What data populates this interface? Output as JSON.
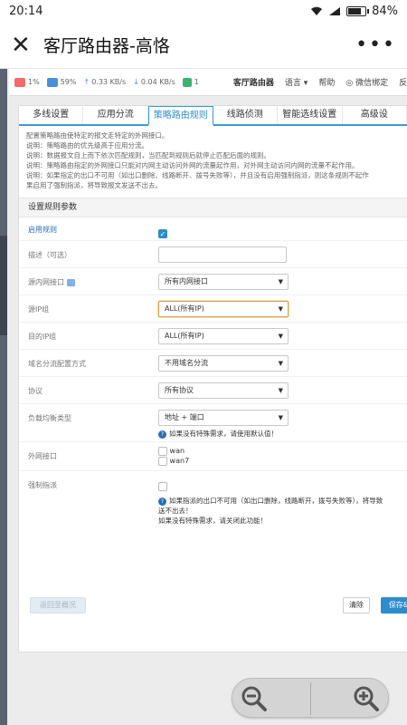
{
  "statusbar": {
    "time": "20:14",
    "battery": "84%",
    "battery_level": 0.84
  },
  "titlebar": {
    "title": "客厅路由器-高恪",
    "more": "•••"
  },
  "routerbar": {
    "cpu": "1%",
    "mem": "59%",
    "up": "0.33 KB/s",
    "down": "0.04 KB/s",
    "sessions": "1",
    "router_name": "客厅路由器",
    "language": "语言",
    "help": "帮助",
    "wechat": "微信绑定",
    "feedback": "反"
  },
  "tabs": [
    "多线设置",
    "应用分流",
    "策略路由规则",
    "线路侦测",
    "智能选线设置",
    "高级设"
  ],
  "active_tab": 2,
  "descriptions": [
    "配置策略路由使特定的报文走特定的外网接口。",
    "说明：策略路由的优先级高于应用分流。",
    "说明：数据报文自上而下依次匹配规则，当匹配到规则后就停止匹配后面的规则。",
    "说明：策略路由指定的外网接口只能对内网主动访问外网的流量起作用，对外网主动访问内网的流量不起作用。",
    "说明：如果指定的出口不可用（如出口删除、线路断开、拨号失败等），并且没有启用强制指派，则这条规则不起作",
    "果启用了强制指派，将导致报文发送不出去。"
  ],
  "form": {
    "section_title": "设置规则参数",
    "enable_label": "启用规则",
    "desc_label": "描述（可选）",
    "src_if_label": "源内网接口",
    "src_if_value": "所有内网接口",
    "src_ip_label": "源IP组",
    "src_ip_value": "ALL(所有IP)",
    "dst_ip_label": "目的IP组",
    "dst_ip_value": "ALL(所有IP)",
    "domain_label": "域名分流配置方式",
    "domain_value": "不用域名分流",
    "proto_label": "协议",
    "proto_value": "所有协议",
    "lb_label": "负载均衡类型",
    "lb_value": "地址 + 端口",
    "lb_hint": "如果没有特殊需求，请使用默认值！",
    "wan_label": "外网接口",
    "wan_options": [
      "wan",
      "wan7"
    ],
    "force_label": "强制指派",
    "force_hint_1": "如果指派的出口不可用（如出口删除，线路断开，拨号失败等），将导致",
    "force_hint_2": "送不出去！",
    "force_hint_3": "如果没有特殊需求，请关闭此功能！"
  },
  "buttons": {
    "back": "返回至概况",
    "clear": "清除",
    "save": "保存&"
  }
}
